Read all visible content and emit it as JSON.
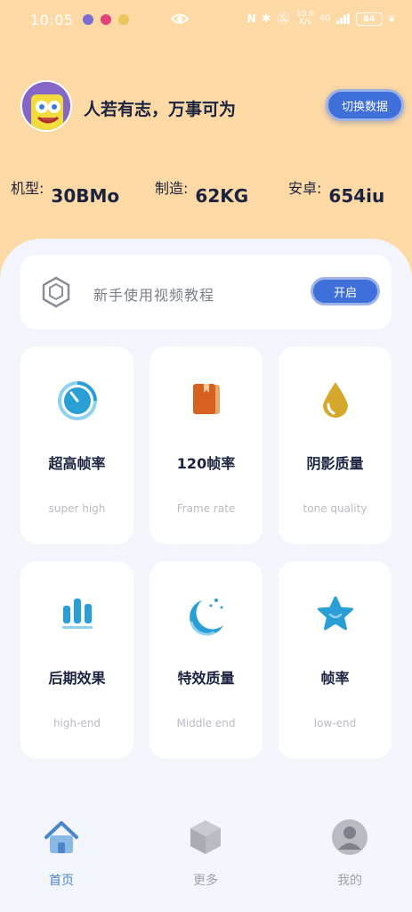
{
  "status_bar": {
    "time": "10:05",
    "net_speed_top": "10.6",
    "net_speed_bottom": "K/s",
    "network": "4G",
    "battery": "84"
  },
  "profile": {
    "motto": "人若有志，万事可为",
    "switch_button": "切换数据"
  },
  "stats": [
    {
      "label": "机型:",
      "value": "30BMo"
    },
    {
      "label": "制造:",
      "value": "62KG"
    },
    {
      "label": "安卓:",
      "value": "654iu"
    }
  ],
  "video_tutorial": {
    "text": "新手使用视频教程",
    "button": "开启"
  },
  "tiles": [
    {
      "title": "超高帧率",
      "subtitle": "super high",
      "icon": "speedometer-icon",
      "color": "#2a9fd6"
    },
    {
      "title": "120帧率",
      "subtitle": "Frame rate",
      "icon": "book-icon",
      "color": "#d5601f"
    },
    {
      "title": "阴影质量",
      "subtitle": "tone quality",
      "icon": "drop-icon",
      "color": "#d4a82a"
    },
    {
      "title": "后期效果",
      "subtitle": "high-end",
      "icon": "bar-chart-icon",
      "color": "#2a9fd6"
    },
    {
      "title": "特效质量",
      "subtitle": "Middle end",
      "icon": "moon-icon",
      "color": "#2a9fd6"
    },
    {
      "title": "帧率",
      "subtitle": "low-end",
      "icon": "star-icon",
      "color": "#2a9fd6"
    }
  ],
  "nav": [
    {
      "label": "首页",
      "active": true
    },
    {
      "label": "更多",
      "active": false
    },
    {
      "label": "我的",
      "active": false
    }
  ],
  "colors": {
    "header_bg": "#fcd9a5",
    "panel_bg": "#f2f5fc",
    "accent": "#3f6fd8",
    "nav_active": "#4a86c8",
    "nav_inactive": "#9ea2aa"
  }
}
